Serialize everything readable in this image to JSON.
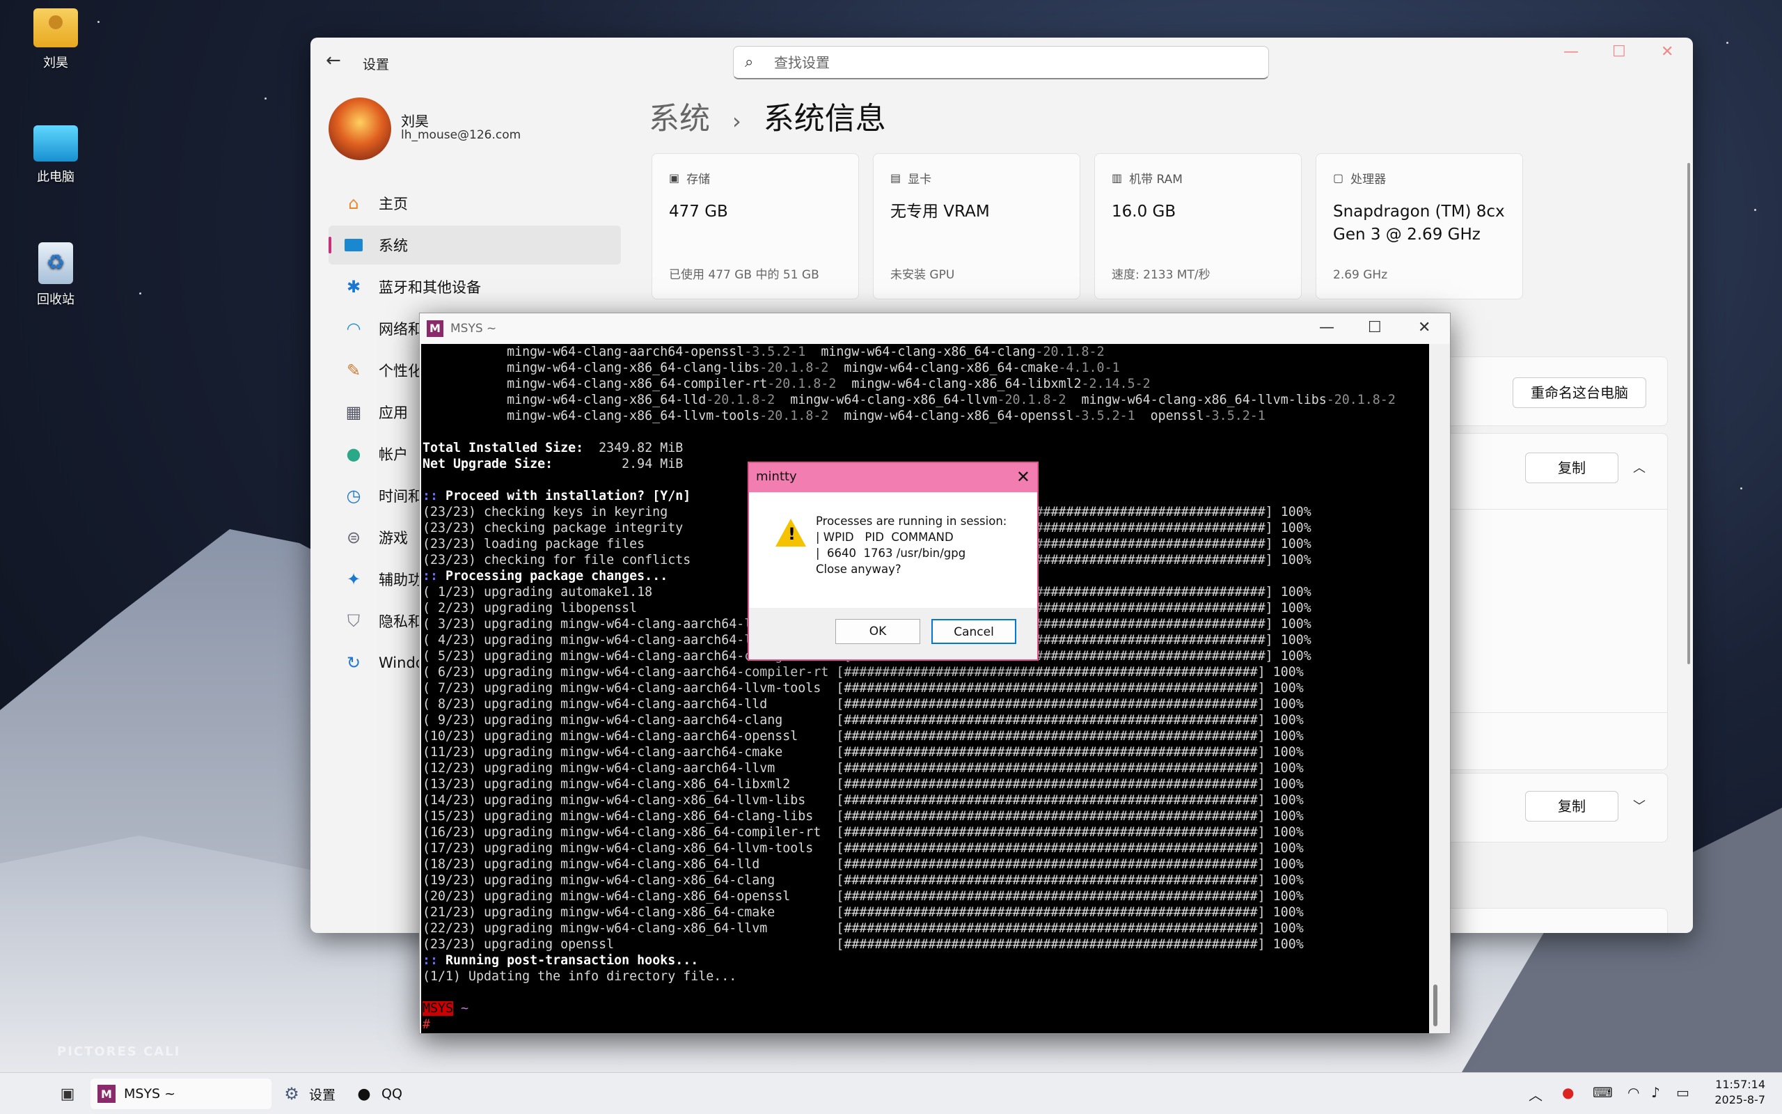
{
  "desktop": {
    "icons": [
      {
        "label": "刘昊",
        "icon": "user-folder-icon"
      },
      {
        "label": "此电脑",
        "icon": "computer-icon"
      },
      {
        "label": "回收站",
        "icon": "recycle-bin-icon"
      }
    ],
    "watermark": "PICTORES CALI"
  },
  "settings": {
    "title": "设置",
    "search_placeholder": "查找设置",
    "user": {
      "name": "刘昊",
      "email": "lh_mouse@126.com"
    },
    "nav": [
      {
        "label": "主页",
        "icon": "home-icon"
      },
      {
        "label": "系统",
        "icon": "system-icon",
        "selected": true
      },
      {
        "label": "蓝牙和其他设备",
        "icon": "bluetooth-icon"
      },
      {
        "label": "网络和",
        "icon": "wifi-icon"
      },
      {
        "label": "个性化",
        "icon": "brush-icon"
      },
      {
        "label": "应用",
        "icon": "apps-icon"
      },
      {
        "label": "帐户",
        "icon": "account-icon"
      },
      {
        "label": "时间和",
        "icon": "clock-icon"
      },
      {
        "label": "游戏",
        "icon": "gamepad-icon"
      },
      {
        "label": "辅助功",
        "icon": "accessibility-icon"
      },
      {
        "label": "隐私和",
        "icon": "shield-icon"
      },
      {
        "label": "Windov",
        "icon": "update-icon"
      }
    ],
    "breadcrumb": {
      "parent": "系统",
      "sep": "›",
      "current": "系统信息"
    },
    "cards": [
      {
        "label": "存储",
        "value": "477 GB",
        "sub": "已使用 477 GB 中的 51 GB",
        "icon": "storage-icon"
      },
      {
        "label": "显卡",
        "value": "无专用 VRAM",
        "sub": "未安装 GPU",
        "icon": "gpu-icon"
      },
      {
        "label": "机带 RAM",
        "value": "16.0 GB",
        "sub": "速度: 2133 MT/秒",
        "icon": "ram-icon"
      },
      {
        "label": "处理器",
        "value": "Snapdragon (TM) 8cx Gen 3 @ 2.69 GHz",
        "sub": "2.69 GHz",
        "icon": "cpu-icon"
      }
    ],
    "rename_button": "重命名这台电脑",
    "copy_button": "复制",
    "copy_button_2": "复制"
  },
  "terminal": {
    "title": "MSYS ~",
    "lines": [
      [
        [
          "",
          "           mingw-w64-clang-aarch64-openssl"
        ],
        [
          "p",
          "-3.5.2-1"
        ],
        [
          "",
          "  mingw-w64-clang-x86_64-clang"
        ],
        [
          "p",
          "-20.1.8-2"
        ]
      ],
      [
        [
          "",
          "           mingw-w64-clang-x86_64-clang-libs"
        ],
        [
          "p",
          "-20.1.8-2"
        ],
        [
          "",
          "  mingw-w64-clang-x86_64-cmake"
        ],
        [
          "p",
          "-4.1.0-1"
        ]
      ],
      [
        [
          "",
          "           mingw-w64-clang-x86_64-compiler-rt"
        ],
        [
          "p",
          "-20.1.8-2"
        ],
        [
          "",
          "  mingw-w64-clang-x86_64-libxml2"
        ],
        [
          "p",
          "-2.14.5-2"
        ]
      ],
      [
        [
          "",
          "           mingw-w64-clang-x86_64-lld"
        ],
        [
          "p",
          "-20.1.8-2"
        ],
        [
          "",
          "  mingw-w64-clang-x86_64-llvm"
        ],
        [
          "p",
          "-20.1.8-2"
        ],
        [
          "",
          "  mingw-w64-clang-x86_64-llvm-libs"
        ],
        [
          "p",
          "-20.1.8-2"
        ]
      ],
      [
        [
          "",
          "           mingw-w64-clang-x86_64-llvm-tools"
        ],
        [
          "p",
          "-20.1.8-2"
        ],
        [
          "",
          "  mingw-w64-clang-x86_64-openssl"
        ],
        [
          "p",
          "-3.5.2-1"
        ],
        [
          "",
          "  openssl"
        ],
        [
          "p",
          "-3.5.2-1"
        ]
      ],
      [
        [
          "",
          ""
        ]
      ],
      [
        [
          "b",
          "Total Installed Size:  "
        ],
        [
          "",
          "2349.82 MiB"
        ]
      ],
      [
        [
          "b",
          "Net Upgrade Size:         "
        ],
        [
          "",
          "2.94 MiB"
        ]
      ],
      [
        [
          "",
          ""
        ]
      ],
      [
        [
          "bl",
          "::"
        ],
        [
          "b",
          " Proceed with installation? [Y/n]"
        ]
      ],
      [
        [
          "",
          "(23/23) checking keys in keyring                       [######################################################] 100%"
        ]
      ],
      [
        [
          "",
          "(23/23) checking package integrity                     [######################################################] 100%"
        ]
      ],
      [
        [
          "",
          "(23/23) loading package files                          [######################################################] 100%"
        ]
      ],
      [
        [
          "",
          "(23/23) checking for file conflicts                    [######################################################] 100%"
        ]
      ],
      [
        [
          "bl",
          "::"
        ],
        [
          "b",
          " Processing package changes..."
        ]
      ],
      [
        [
          "",
          "( 1/23) upgrading automake1.18                         [######################################################] 100%"
        ]
      ],
      [
        [
          "",
          "( 2/23) upgrading libopenssl                           [######################################################] 100%"
        ]
      ],
      [
        [
          "",
          "( 3/23) upgrading mingw-w64-clang-aarch64-libxml2      [######################################################] 100%"
        ]
      ],
      [
        [
          "",
          "( 4/23) upgrading mingw-w64-clang-aarch64-llvm-libs    [######################################################] 100%"
        ]
      ],
      [
        [
          "",
          "( 5/23) upgrading mingw-w64-clang-aarch64-clang-libs   [######################################################] 100%"
        ]
      ],
      [
        [
          "",
          "( 6/23) upgrading mingw-w64-clang-aarch64-compiler-rt [######################################################] 100%"
        ]
      ],
      [
        [
          "",
          "( 7/23) upgrading mingw-w64-clang-aarch64-llvm-tools  [######################################################] 100%"
        ]
      ],
      [
        [
          "",
          "( 8/23) upgrading mingw-w64-clang-aarch64-lld         [######################################################] 100%"
        ]
      ],
      [
        [
          "",
          "( 9/23) upgrading mingw-w64-clang-aarch64-clang       [######################################################] 100%"
        ]
      ],
      [
        [
          "",
          "(10/23) upgrading mingw-w64-clang-aarch64-openssl     [######################################################] 100%"
        ]
      ],
      [
        [
          "",
          "(11/23) upgrading mingw-w64-clang-aarch64-cmake       [######################################################] 100%"
        ]
      ],
      [
        [
          "",
          "(12/23) upgrading mingw-w64-clang-aarch64-llvm        [######################################################] 100%"
        ]
      ],
      [
        [
          "",
          "(13/23) upgrading mingw-w64-clang-x86_64-libxml2      [######################################################] 100%"
        ]
      ],
      [
        [
          "",
          "(14/23) upgrading mingw-w64-clang-x86_64-llvm-libs    [######################################################] 100%"
        ]
      ],
      [
        [
          "",
          "(15/23) upgrading mingw-w64-clang-x86_64-clang-libs   [######################################################] 100%"
        ]
      ],
      [
        [
          "",
          "(16/23) upgrading mingw-w64-clang-x86_64-compiler-rt  [######################################################] 100%"
        ]
      ],
      [
        [
          "",
          "(17/23) upgrading mingw-w64-clang-x86_64-llvm-tools   [######################################################] 100%"
        ]
      ],
      [
        [
          "",
          "(18/23) upgrading mingw-w64-clang-x86_64-lld          [######################################################] 100%"
        ]
      ],
      [
        [
          "",
          "(19/23) upgrading mingw-w64-clang-x86_64-clang        [######################################################] 100%"
        ]
      ],
      [
        [
          "",
          "(20/23) upgrading mingw-w64-clang-x86_64-openssl      [######################################################] 100%"
        ]
      ],
      [
        [
          "",
          "(21/23) upgrading mingw-w64-clang-x86_64-cmake        [######################################################] 100%"
        ]
      ],
      [
        [
          "",
          "(22/23) upgrading mingw-w64-clang-x86_64-llvm         [######################################################] 100%"
        ]
      ],
      [
        [
          "",
          "(23/23) upgrading openssl                             [######################################################] 100%"
        ]
      ],
      [
        [
          "bl",
          "::"
        ],
        [
          "b",
          " Running post-transaction hooks..."
        ]
      ],
      [
        [
          "",
          "(1/1) Updating the info directory file..."
        ]
      ],
      [
        [
          "",
          ""
        ]
      ],
      [
        [
          "bad",
          "MSYS"
        ],
        [
          "pur",
          " ~"
        ]
      ],
      [
        [
          "red",
          "#"
        ],
        [
          "",
          " "
        ]
      ]
    ]
  },
  "dialog": {
    "title": "mintty",
    "message": "Processes are running in session:\n| WPID   PID  COMMAND\n|  6640  1763 /usr/bin/gpg\nClose anyway?",
    "ok": "OK",
    "cancel": "Cancel"
  },
  "taskbar": {
    "items": [
      {
        "label": "MSYS ~",
        "icon": "msys-icon"
      },
      {
        "label": "设置",
        "icon": "settings-gear-icon"
      },
      {
        "label": "QQ",
        "icon": "qq-icon"
      }
    ],
    "time": "11:57:14",
    "date": "2025-8-7"
  }
}
